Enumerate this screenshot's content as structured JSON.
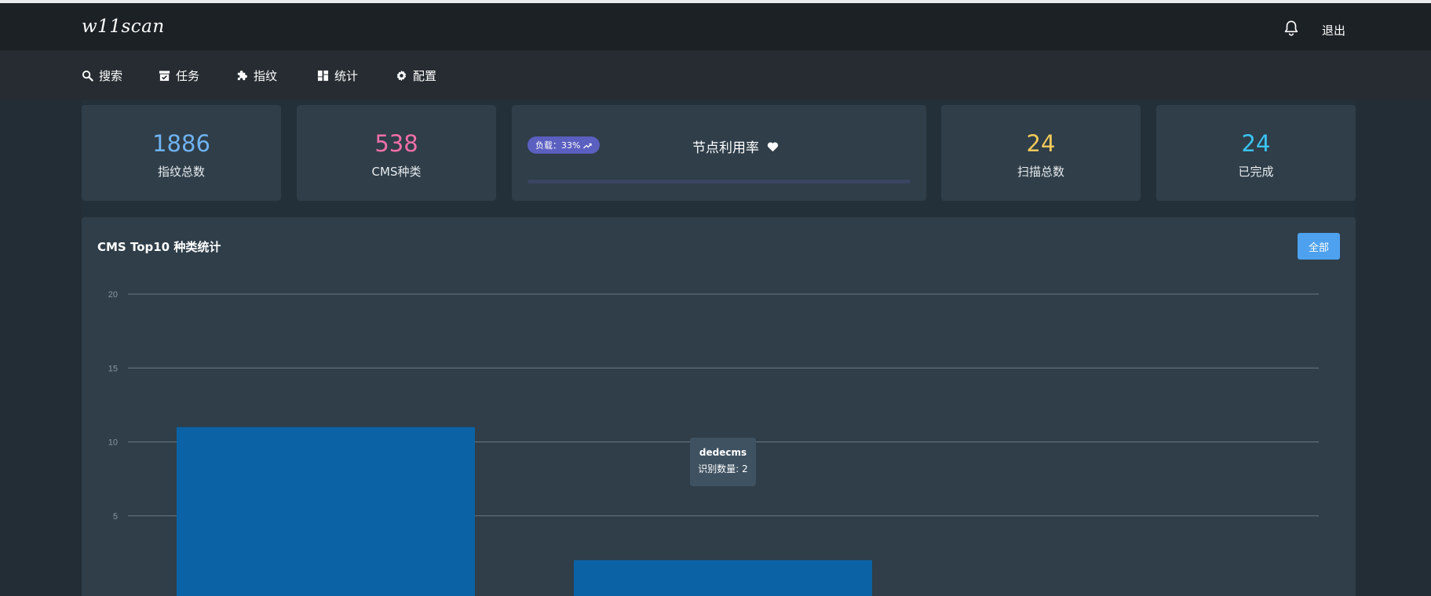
{
  "app": {
    "logo": "w11scan"
  },
  "header": {
    "logout_label": "退出"
  },
  "nav": {
    "items": [
      {
        "label": "搜索",
        "icon": "search-icon"
      },
      {
        "label": "任务",
        "icon": "task-icon"
      },
      {
        "label": "指纹",
        "icon": "puzzle-icon"
      },
      {
        "label": "统计",
        "icon": "dashboard-icon"
      },
      {
        "label": "配置",
        "icon": "gear-icon"
      }
    ]
  },
  "stats": {
    "fingerprint_total": {
      "value": "1886",
      "label": "指纹总数",
      "color": "#6fb3f2"
    },
    "cms_types": {
      "value": "538",
      "label": "CMS种类",
      "color": "#f36fa8"
    },
    "scan_total": {
      "value": "24",
      "label": "扫描总数",
      "color": "#f5c95a"
    },
    "completed": {
      "value": "24",
      "label": "已完成",
      "color": "#3ac3f2"
    }
  },
  "node": {
    "badge_label": "负载：33%",
    "title": "节点利用率",
    "load_fraction": 0.33
  },
  "chart_section": {
    "title": "CMS Top10 种类统计",
    "all_button_label": "全部",
    "tooltip": {
      "name": "dedecms",
      "value_label": "识别数量: 2"
    }
  },
  "chart_data": {
    "type": "bar",
    "categories": [
      "",
      "dedecms"
    ],
    "values": [
      11,
      2
    ],
    "bar_color": "#0b63a6",
    "y_ticks": [
      5,
      10,
      15,
      20
    ],
    "ylim": [
      0,
      20
    ],
    "grid": true,
    "title": "",
    "xlabel": "",
    "ylabel": ""
  }
}
